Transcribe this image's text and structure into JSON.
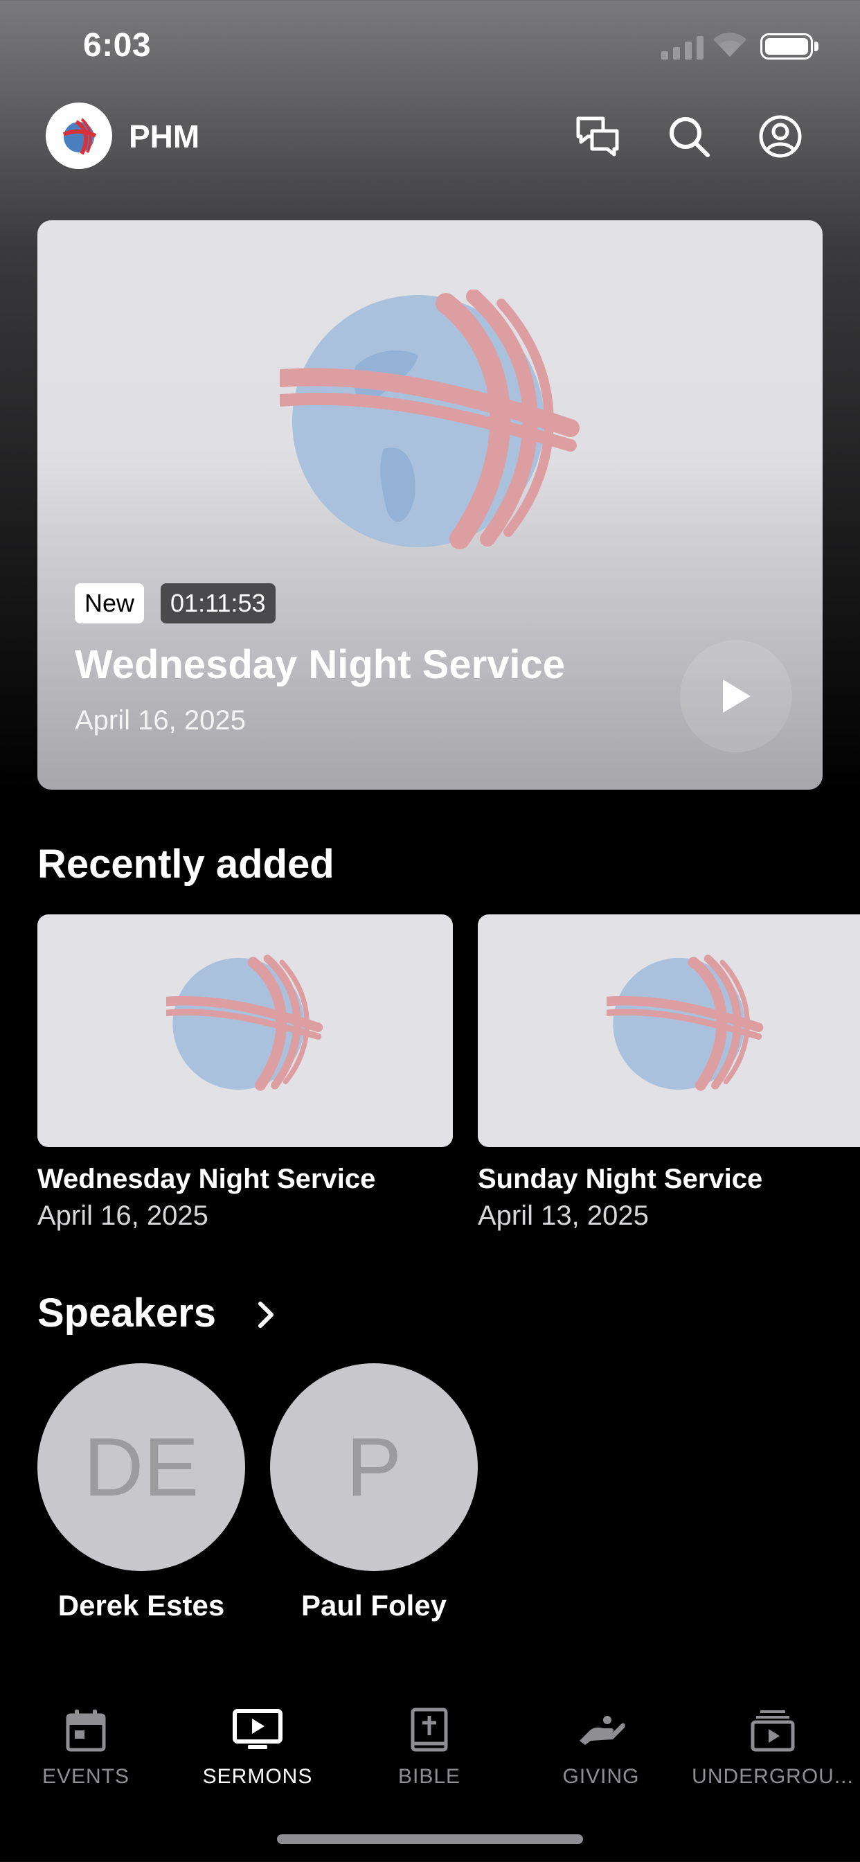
{
  "status_bar": {
    "time": "6:03"
  },
  "header": {
    "title": "PHM"
  },
  "featured": {
    "badge_new": "New",
    "duration": "01:11:53",
    "title": "Wednesday Night Service",
    "date": "April 16, 2025"
  },
  "recently_added": {
    "title": "Recently added",
    "items": [
      {
        "title": "Wednesday Night Service",
        "date": "April 16, 2025"
      },
      {
        "title": "Sunday Night Service",
        "date": "April 13, 2025"
      }
    ]
  },
  "speakers": {
    "title": "Speakers",
    "items": [
      {
        "initials": "DE",
        "name": "Derek Estes"
      },
      {
        "initials": "P",
        "name": "Paul Foley"
      }
    ]
  },
  "tabbar": {
    "items": [
      {
        "label": "EVENTS",
        "icon": "calendar-icon"
      },
      {
        "label": "SERMONS",
        "icon": "tv-play-icon",
        "active": true
      },
      {
        "label": "BIBLE",
        "icon": "bible-icon"
      },
      {
        "label": "GIVING",
        "icon": "giving-hand-icon"
      },
      {
        "label": "UNDERGROU...",
        "icon": "media-stack-icon"
      }
    ]
  },
  "colors": {
    "accent": "#ffffff",
    "inactive": "#8e8e93",
    "brand_red": "#d9313a",
    "brand_blue": "#4a7fc1"
  }
}
